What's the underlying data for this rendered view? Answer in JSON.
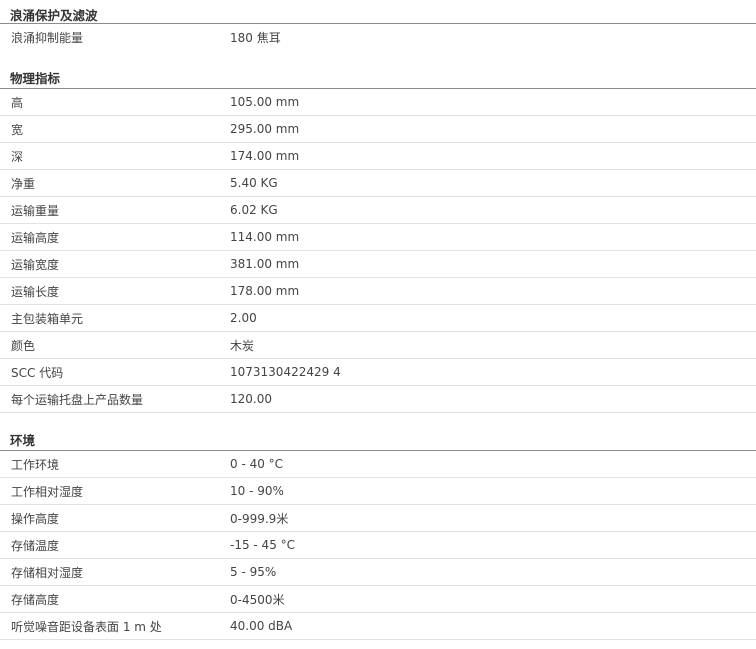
{
  "sections": [
    {
      "title": "浪涌保护及滤波",
      "rows": [
        {
          "label": "浪涌抑制能量",
          "value": "180 焦耳"
        }
      ]
    },
    {
      "title": "物理指标",
      "rows": [
        {
          "label": "高",
          "value": "105.00 mm"
        },
        {
          "label": "宽",
          "value": "295.00 mm"
        },
        {
          "label": "深",
          "value": "174.00 mm"
        },
        {
          "label": "净重",
          "value": "5.40 KG"
        },
        {
          "label": "运输重量",
          "value": "6.02 KG"
        },
        {
          "label": "运输高度",
          "value": "114.00 mm"
        },
        {
          "label": "运输宽度",
          "value": "381.00 mm"
        },
        {
          "label": "运输长度",
          "value": "178.00 mm"
        },
        {
          "label": "主包装箱单元",
          "value": "2.00"
        },
        {
          "label": "颜色",
          "value": "木炭"
        },
        {
          "label": "SCC 代码",
          "value": "1073130422429 4"
        },
        {
          "label": "每个运输托盘上产品数量",
          "value": "120.00"
        }
      ]
    },
    {
      "title": "环境",
      "rows": [
        {
          "label": "工作环境",
          "value": "0 - 40 °C"
        },
        {
          "label": "工作相对湿度",
          "value": "10 - 90%"
        },
        {
          "label": "操作高度",
          "value": "0-999.9米"
        },
        {
          "label": "存储温度",
          "value": "-15 - 45 °C"
        },
        {
          "label": "存储相对湿度",
          "value": "5 - 95%"
        },
        {
          "label": "存储高度",
          "value": "0-4500米"
        },
        {
          "label": "听觉噪音距设备表面 1 m 处",
          "value": "40.00 dBA"
        }
      ]
    }
  ]
}
